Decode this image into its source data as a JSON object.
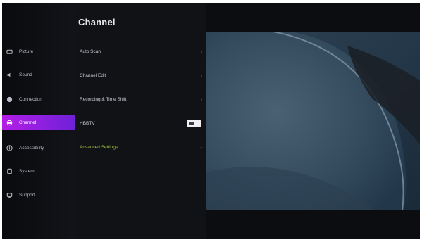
{
  "sidebar": {
    "items": [
      {
        "label": "Picture",
        "icon": "picture-icon",
        "active": false
      },
      {
        "label": "Sound",
        "icon": "sound-icon",
        "active": false
      },
      {
        "label": "Connection",
        "icon": "connection-icon",
        "active": false
      },
      {
        "label": "Channel",
        "icon": "channel-icon",
        "active": true
      },
      {
        "label": "Accessibility",
        "icon": "accessibility-icon",
        "active": false
      },
      {
        "label": "System",
        "icon": "system-icon",
        "active": false
      },
      {
        "label": "Support",
        "icon": "support-icon",
        "active": false
      }
    ]
  },
  "panel": {
    "title": "Channel",
    "items": [
      {
        "label": "Auto Scan",
        "control": "chevron"
      },
      {
        "label": "Channel Edit",
        "control": "chevron"
      },
      {
        "label": "Recording & Time Shift",
        "control": "chevron"
      },
      {
        "label": "HBBTV",
        "control": "toggle",
        "value": "on"
      },
      {
        "label": "Advanced Settings",
        "control": "chevron"
      }
    ]
  },
  "colors": {
    "accent_start": "#b41ee6",
    "accent_end": "#6e21d8",
    "highlight_text": "#a4c43a"
  }
}
